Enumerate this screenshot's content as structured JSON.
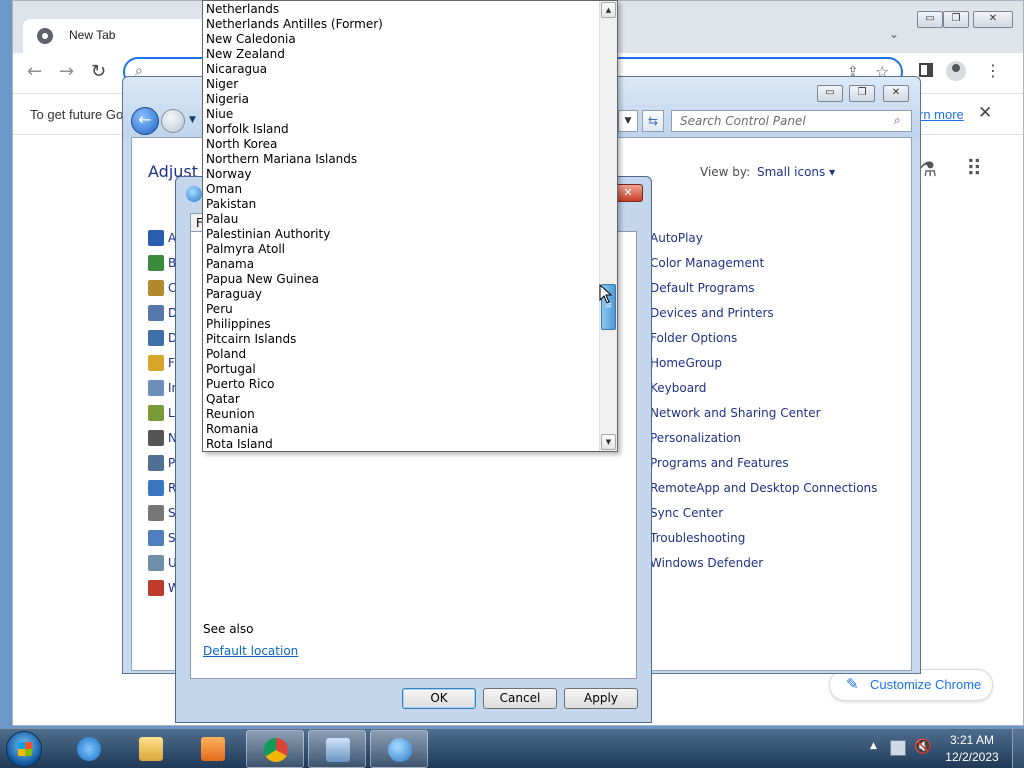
{
  "chrome": {
    "tab_title": "New Tab",
    "infobar_text": "To get future Go",
    "infobar_link": "rn more",
    "customize_label": "Customize Chrome",
    "win_controls": {
      "minimize": "▭",
      "restore": "❐",
      "close": "✕"
    }
  },
  "control_panel": {
    "search_placeholder": "Search Control Panel",
    "heading": "Adjust y",
    "view_by_label": "View by:",
    "view_by_value": "Small icons ▾",
    "left_items": [
      "A",
      "B",
      "C",
      "D",
      "D",
      "F",
      "In",
      "Le",
      "N",
      "P",
      "R",
      "Sc",
      "Sy",
      "U",
      "W"
    ],
    "left_icon_colors": [
      "#2a5db0",
      "#3c8a3c",
      "#b08a2a",
      "#5577aa",
      "#3f6fa8",
      "#d8a52b",
      "#6d8fb8",
      "#7a9a3a",
      "#555555",
      "#4f6f94",
      "#3a77c0",
      "#777777",
      "#4f7fbf",
      "#6f8fa8",
      "#c0392b"
    ],
    "right_items": [
      "AutoPlay",
      "Color Management",
      "Default Programs",
      "Devices and Printers",
      "Folder Options",
      "HomeGroup",
      "Keyboard",
      "Network and Sharing Center",
      "Personalization",
      "Programs and Features",
      "RemoteApp and Desktop Connections",
      "Sync Center",
      "Troubleshooting",
      "Windows Defender"
    ]
  },
  "region_dialog": {
    "tab_letter": "F",
    "see_also": "See also",
    "default_location_link": "Default location",
    "ok_label": "OK",
    "cancel_label": "Cancel",
    "apply_label": "Apply"
  },
  "dropdown": {
    "items": [
      "Netherlands",
      "Netherlands Antilles (Former)",
      "New Caledonia",
      "New Zealand",
      "Nicaragua",
      "Niger",
      "Nigeria",
      "Niue",
      "Norfolk Island",
      "North Korea",
      "Northern Mariana Islands",
      "Norway",
      "Oman",
      "Pakistan",
      "Palau",
      "Palestinian Authority",
      "Palmyra Atoll",
      "Panama",
      "Papua New Guinea",
      "Paraguay",
      "Peru",
      "Philippines",
      "Pitcairn Islands",
      "Poland",
      "Portugal",
      "Puerto Rico",
      "Qatar",
      "Reunion",
      "Romania",
      "Rota Island"
    ]
  },
  "taskbar": {
    "time": "3:21 AM",
    "date": "12/2/2023"
  }
}
